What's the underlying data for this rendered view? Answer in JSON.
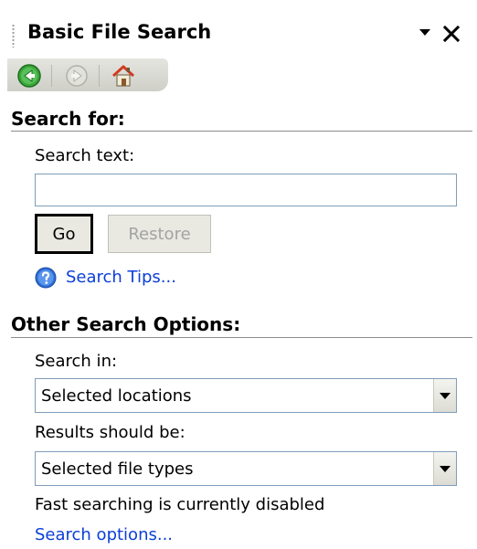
{
  "pane": {
    "title": "Basic File Search",
    "menu_icon": "chevron-down-icon",
    "close_icon": "close-icon"
  },
  "nav": {
    "back_icon": "back-arrow-icon",
    "forward_icon": "forward-arrow-icon",
    "home_icon": "home-icon"
  },
  "search_for": {
    "header": "Search for:",
    "search_text_label": "Search text:",
    "search_text_value": "",
    "go_label": "Go",
    "restore_label": "Restore",
    "tips_icon": "help-icon",
    "tips_link": "Search Tips..."
  },
  "other_options": {
    "header": "Other Search Options:",
    "search_in_label": "Search in:",
    "search_in_value": "Selected locations",
    "results_label": "Results should be:",
    "results_value": "Selected file types",
    "fast_search_status": "Fast searching is currently disabled",
    "search_options_link": "Search options..."
  },
  "colors": {
    "link": "#0b3fd8",
    "rule": "#8c8c8c",
    "disabled_text": "#a3a3a3",
    "back_button": "#3aa63a",
    "home_roof": "#d23b1e"
  }
}
